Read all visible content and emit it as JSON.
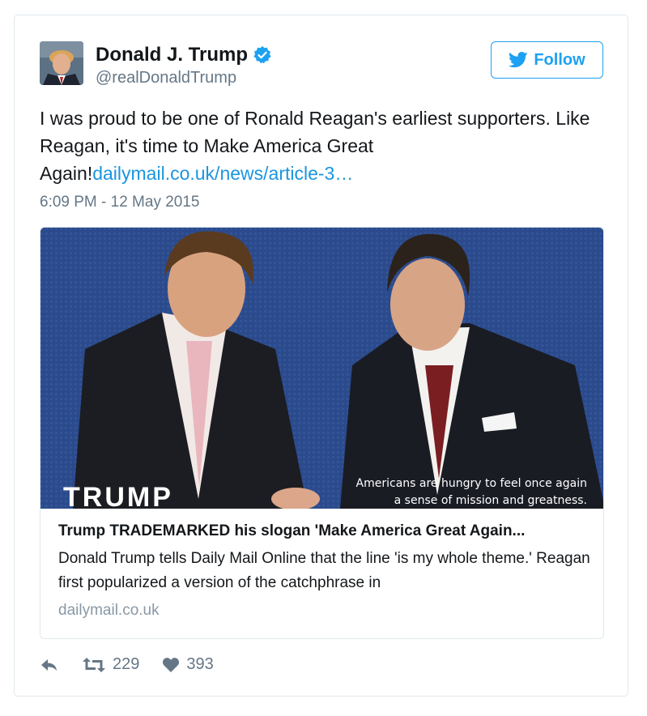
{
  "tweet": {
    "author_name": "Donald J. Trump",
    "author_handle": "@realDonaldTrump",
    "follow_label": "Follow",
    "text_main": "I was proud to be one of Ronald Reagan's earliest supporters. Like Reagan, it's time to Make America Great Again!",
    "text_link": "dailymail.co.uk/news/article-3…",
    "timestamp": "6:09 PM - 12 May 2015"
  },
  "link_card": {
    "image_caption_line1": "Americans are hungry to feel once again",
    "image_caption_line2": "a sense of mission and greatness.",
    "image_logo_text": "TRUMP",
    "title": "Trump TRADEMARKED his slogan 'Make America Great Again...",
    "description": "Donald Trump tells Daily Mail Online that the line 'is my whole theme.' Reagan first popularized a version of the catchphrase in",
    "domain": "dailymail.co.uk"
  },
  "actions": {
    "retweet_count": "229",
    "like_count": "393"
  },
  "icons": [
    "verified-badge-icon",
    "twitter-bird-icon",
    "reply-icon",
    "retweet-icon",
    "heart-icon"
  ],
  "colors": {
    "accent": "#1da1f2",
    "link": "#1b95e0",
    "muted": "#657786",
    "border": "#e1e8ed"
  }
}
